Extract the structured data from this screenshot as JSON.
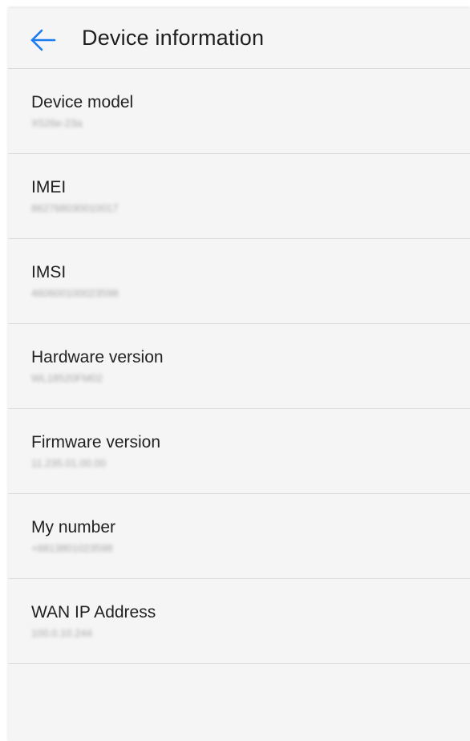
{
  "header": {
    "back_icon": "arrow-left-icon",
    "title": "Device information",
    "accent_color": "#1a7cf0"
  },
  "rows": [
    {
      "label": "Device model",
      "value": "X526e-23a"
    },
    {
      "label": "IMEI",
      "value": "862768030010017"
    },
    {
      "label": "IMSI",
      "value": "460600100023598"
    },
    {
      "label": "Hardware version",
      "value": "WL18520FM02"
    },
    {
      "label": "Firmware version",
      "value": "11.235.01.00.00"
    },
    {
      "label": "My number",
      "value": "+6813801023598"
    },
    {
      "label": "WAN IP Address",
      "value": "100.0.10.244"
    }
  ]
}
